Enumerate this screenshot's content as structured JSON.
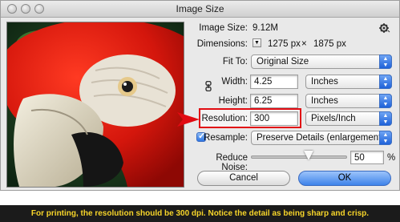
{
  "window": {
    "title": "Image Size"
  },
  "image_size": {
    "label": "Image Size:",
    "value": "9.12M"
  },
  "dimensions": {
    "label": "Dimensions:",
    "width_value": "1275 px",
    "separator": "×",
    "height_value": "1875 px"
  },
  "fit_to": {
    "label": "Fit To:",
    "value": "Original Size"
  },
  "width": {
    "label": "Width:",
    "value": "4.25",
    "unit": "Inches"
  },
  "height": {
    "label": "Height:",
    "value": "6.25",
    "unit": "Inches"
  },
  "resolution": {
    "label": "Resolution:",
    "value": "300",
    "unit": "Pixels/Inch"
  },
  "resample": {
    "label": "Resample:",
    "checked": true,
    "method": "Preserve Details (enlargement)"
  },
  "reduce_noise": {
    "label": "Reduce Noise:",
    "value": "50",
    "unit": "%",
    "slider_level": 0.5
  },
  "buttons": {
    "cancel": "Cancel",
    "ok": "OK"
  },
  "caption": "For printing, the resolution should be 300 dpi. Notice the detail as being sharp and crisp.",
  "colors": {
    "highlight": "#e10b12",
    "banner_text": "#f7d52a",
    "banner_bg": "#1b1b1b",
    "accent": "#2a6fe0"
  }
}
